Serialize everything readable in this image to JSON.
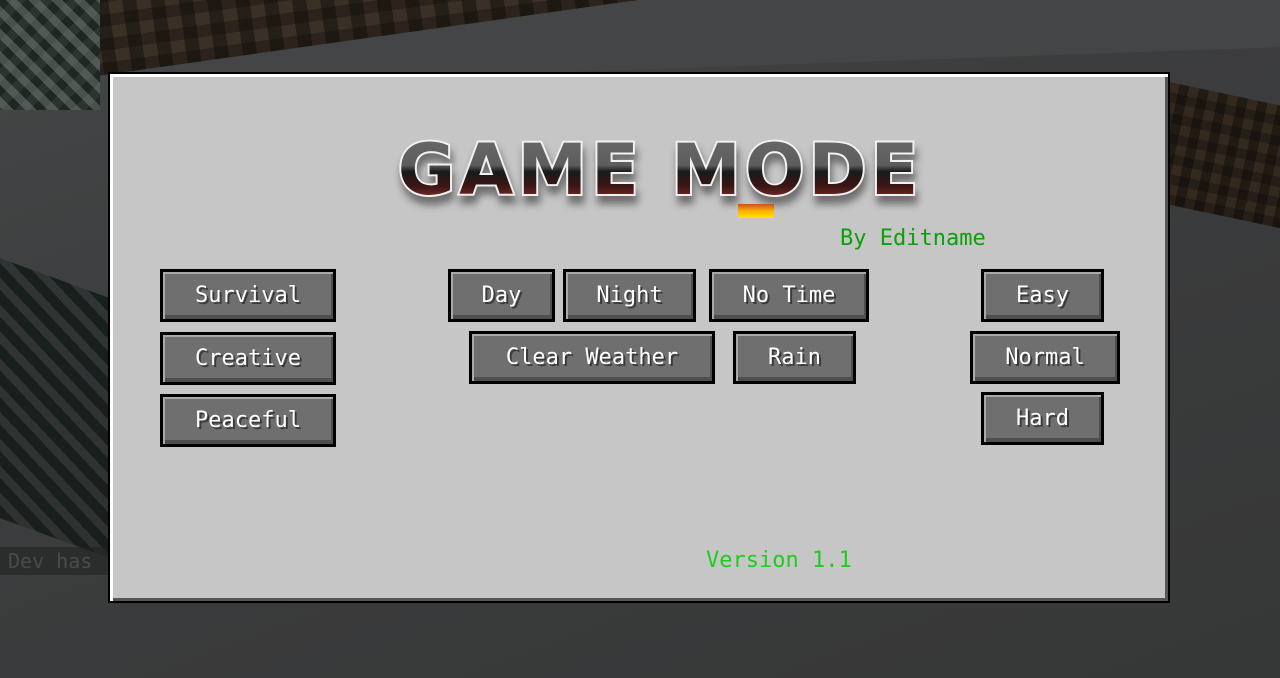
{
  "background": {
    "chat_text": "Dev has"
  },
  "panel": {
    "title": "GAME MODE",
    "credit": "By Editname",
    "version": "Version 1.1",
    "colors": {
      "panel_bg": "#c6c6c6",
      "credit": "#0aa00a",
      "version": "#1fcc1f",
      "button_bg": "#6f6f6f",
      "button_text": "#ffffff"
    }
  },
  "gamemode_buttons": [
    {
      "label": "Survival"
    },
    {
      "label": "Creative"
    },
    {
      "label": "Peaceful"
    }
  ],
  "time_buttons": [
    {
      "label": "Day"
    },
    {
      "label": "Night"
    },
    {
      "label": "No Time"
    }
  ],
  "weather_buttons": [
    {
      "label": "Clear Weather"
    },
    {
      "label": "Rain"
    }
  ],
  "difficulty_buttons": [
    {
      "label": "Easy"
    },
    {
      "label": "Normal"
    },
    {
      "label": "Hard"
    }
  ]
}
